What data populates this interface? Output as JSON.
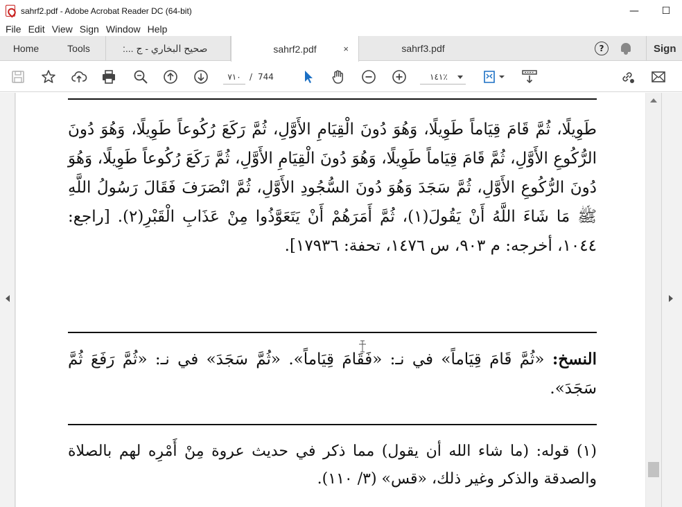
{
  "window": {
    "title": "sahrf2.pdf - Adobe Acrobat Reader DC (64-bit)",
    "minimize": "—",
    "maximize": "☐"
  },
  "menu": [
    "File",
    "Edit",
    "View",
    "Sign",
    "Window",
    "Help"
  ],
  "tabs": {
    "home": "Home",
    "tools": "Tools",
    "docs": [
      {
        "label": "صحيح البخاري - ج ...:",
        "active": false
      },
      {
        "label": "sahrf2.pdf",
        "active": true,
        "close": "×"
      },
      {
        "label": "sahrf3.pdf",
        "active": false
      }
    ],
    "help": "?",
    "sign": "Sign"
  },
  "toolbar": {
    "current_page": "٧١٠",
    "page_separator": "/",
    "total_pages": "744",
    "zoom": "١٤١٪"
  },
  "colors": {
    "accent_blue": "#1a6fc4",
    "pdf_red": "#c8201e"
  },
  "document": {
    "main_text": "طَوِيلًا، ثُمَّ قَامَ قِيَاماً طَوِيلًا، وَهُوَ دُونَ الْقِيَامِ الأَوَّلِ، ثُمَّ رَكَعَ رُكُوعاً طَوِيلًا، وَهُوَ دُونَ الرُّكُوعِ الأَوَّلِ، ثُمَّ قَامَ قِيَاماً طَوِيلًا، وَهُوَ دُونَ الْقِيَامِ الأَوَّلِ، ثُمَّ رَكَعَ رُكُوعاً طَوِيلًا، وَهُوَ دُونَ الرُّكُوعِ الأَوَّلِ، ثُمَّ سَجَدَ وَهُوَ دُونَ السُّجُودِ الأَوَّلِ، ثُمَّ انْصَرَفَ فَقَالَ رَسُولُ اللَّهِ ﷺ مَا شَاءَ اللَّهُ أَنْ يَقُولَ(١)، ثُمَّ أَمَرَهُمْ أَنْ يَتَعَوَّذُوا مِنْ عَذَابِ الْقَبْرِ(٢). [راجع: ١٠٤٤، أخرجه: م ٩٠٣، س ١٤٧٦، تحفة: ١٧٩٣٦].",
    "nuskh_label": "النسخ:",
    "nuskh_text": "«ثُمَّ قَامَ قِيَاماً» في نـ: «فَقَامَ قِيَاماً». «ثُمَّ سَجَدَ» في نـ: «ثُمَّ رَفَعَ ثُمَّ سَجَدَ».",
    "footnote": "(١) قوله: (ما شاء الله أن يقول) مما ذكر في حديث عروة مِنْ أَمْرِه لهم بالصلاة والصدقة والذكر وغير ذلك، «قس» (٣/ ١١٠)."
  }
}
